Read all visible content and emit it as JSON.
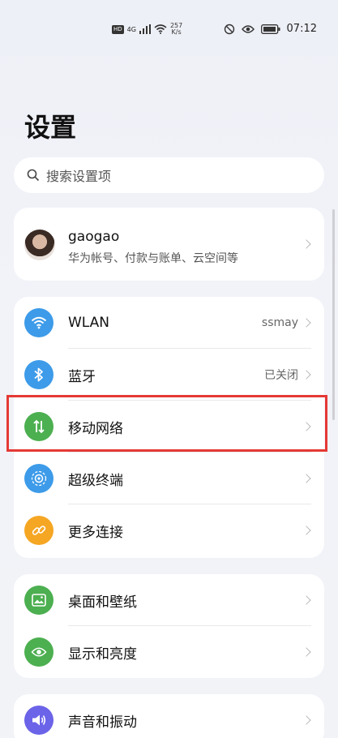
{
  "status_bar": {
    "net_badge": "HD",
    "signal_prefix": "4G",
    "speed_value": "257",
    "speed_unit": "K/s",
    "time": "07:12"
  },
  "page": {
    "title": "设置"
  },
  "search": {
    "placeholder": "搜索设置项"
  },
  "profile": {
    "name": "gaogao",
    "subtitle": "华为帐号、付款与账单、云空间等"
  },
  "group_connectivity": {
    "items": [
      {
        "label": "WLAN",
        "value": "ssmay",
        "icon": "wifi-icon",
        "color": "#3d9be9"
      },
      {
        "label": "蓝牙",
        "value": "已关闭",
        "icon": "bluetooth-icon",
        "color": "#3d9be9"
      },
      {
        "label": "移动网络",
        "value": "",
        "icon": "mobile-data-icon",
        "color": "#4caf50"
      },
      {
        "label": "超级终端",
        "value": "",
        "icon": "super-device-icon",
        "color": "#3d9be9"
      },
      {
        "label": "更多连接",
        "value": "",
        "icon": "link-icon",
        "color": "#f5a623"
      }
    ]
  },
  "group_display": {
    "items": [
      {
        "label": "桌面和壁纸",
        "icon": "wallpaper-icon",
        "color": "#4caf50"
      },
      {
        "label": "显示和亮度",
        "icon": "eye-icon",
        "color": "#4caf50"
      }
    ]
  },
  "group_sound": {
    "items": [
      {
        "label": "声音和振动",
        "icon": "speaker-icon",
        "color": "#6b63e8"
      }
    ]
  },
  "highlight_color": "#e53935"
}
